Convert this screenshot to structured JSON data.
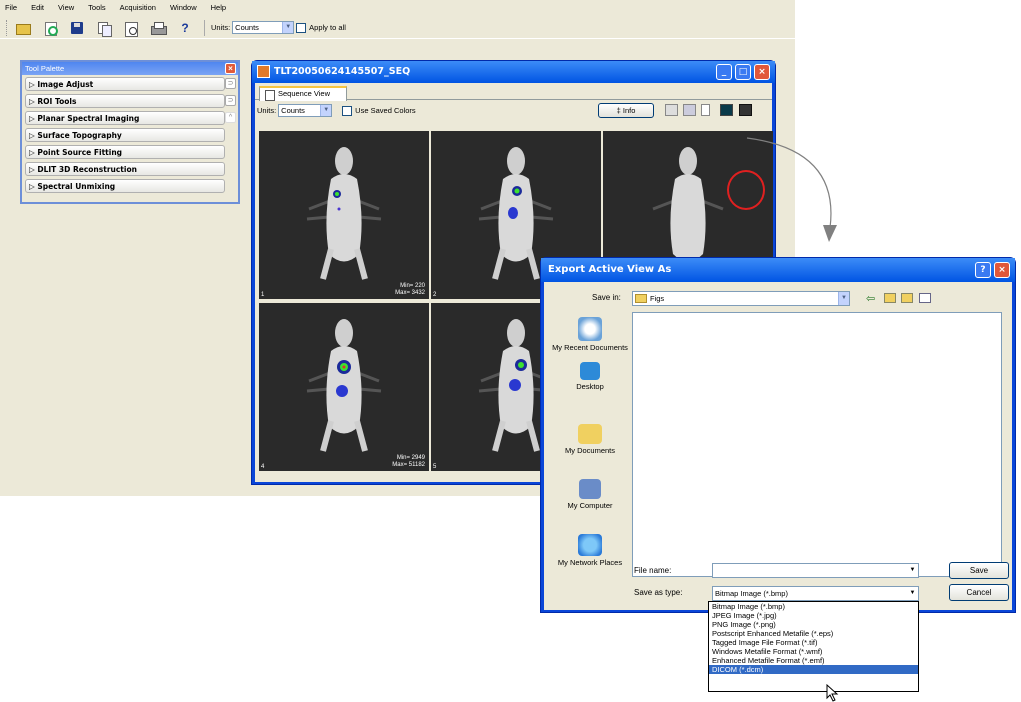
{
  "menu": [
    "File",
    "Edit",
    "View",
    "Tools",
    "Acquisition",
    "Window",
    "Help"
  ],
  "toolbar": {
    "units_label": "Units:",
    "units_value": "Counts",
    "apply_all": "Apply to all"
  },
  "palette": {
    "title": "Tool Palette",
    "items": [
      "Image Adjust",
      "ROI Tools",
      "Planar Spectral Imaging",
      "Surface Topography",
      "Point Source Fitting",
      "DLIT 3D Reconstruction",
      "Spectral Unmixing"
    ]
  },
  "sequence": {
    "title": "TLT20050624145507_SEQ",
    "tab": "Sequence View",
    "units_label": "Units:",
    "units_value": "Counts",
    "saved_colors": "Use Saved Colors",
    "info_btn": "‡ Info",
    "cells": [
      {
        "num": "1",
        "mm": [
          "Min= 220",
          "Max= 3432"
        ]
      },
      {
        "num": "2",
        "mm": [
          "",
          ""
        ]
      },
      {
        "num": "",
        "mm": [
          "",
          ""
        ]
      },
      {
        "num": "4",
        "mm": [
          "Min= 2949",
          "Max= 51182"
        ]
      },
      {
        "num": "5",
        "mm": [
          "",
          ""
        ]
      },
      {
        "num": "",
        "mm": [
          "",
          ""
        ]
      }
    ]
  },
  "export": {
    "title": "Export Active View As",
    "save_in_label": "Save in:",
    "save_in_value": "Figs",
    "places": [
      "My Recent Documents",
      "Desktop",
      "My Documents",
      "My Computer",
      "My Network Places"
    ],
    "file_name_label": "File name:",
    "file_name_value": "",
    "save_type_label": "Save as type:",
    "save_type_value": "Bitmap Image (*.bmp)",
    "save_btn": "Save",
    "cancel_btn": "Cancel",
    "type_options": [
      "Bitmap Image (*.bmp)",
      "JPEG Image (*.jpg)",
      "PNG Image (*.png)",
      "Postscript Enhanced Metafile (*.eps)",
      "Tagged Image File Format (*.tif)",
      "Windows Metafile Format (*.wmf)",
      "Enhanced Metafile Format (*.emf)",
      "DICOM (*.dcm)"
    ],
    "selected_option": "DICOM (*.dcm)"
  },
  "colors": {
    "xp_blue": "#0a46d8",
    "xp_face": "#ECE9D8",
    "highlight": "#316ac5",
    "annotation_red": "#e02020"
  }
}
